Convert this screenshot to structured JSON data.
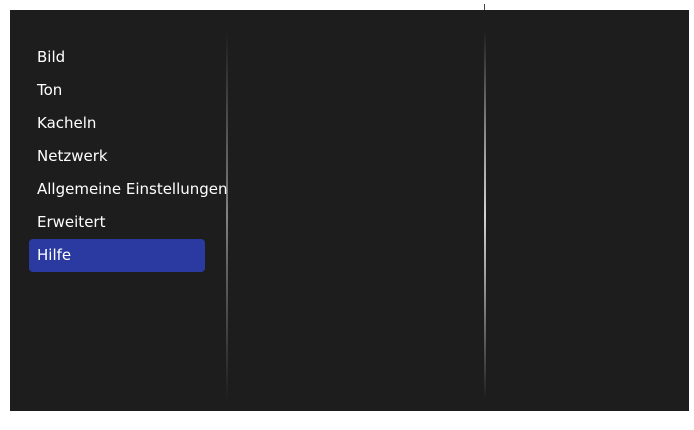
{
  "menu": {
    "items": [
      {
        "label": "Bild",
        "selected": false
      },
      {
        "label": "Ton",
        "selected": false
      },
      {
        "label": "Kacheln",
        "selected": false
      },
      {
        "label": "Netzwerk",
        "selected": false
      },
      {
        "label": "Allgemeine Einstellungen",
        "selected": false
      },
      {
        "label": "Erweitert",
        "selected": false
      },
      {
        "label": "Hilfe",
        "selected": true
      }
    ]
  },
  "colors": {
    "background": "#1d1d1d",
    "selection": "#2a3aa0",
    "text": "#ffffff"
  }
}
